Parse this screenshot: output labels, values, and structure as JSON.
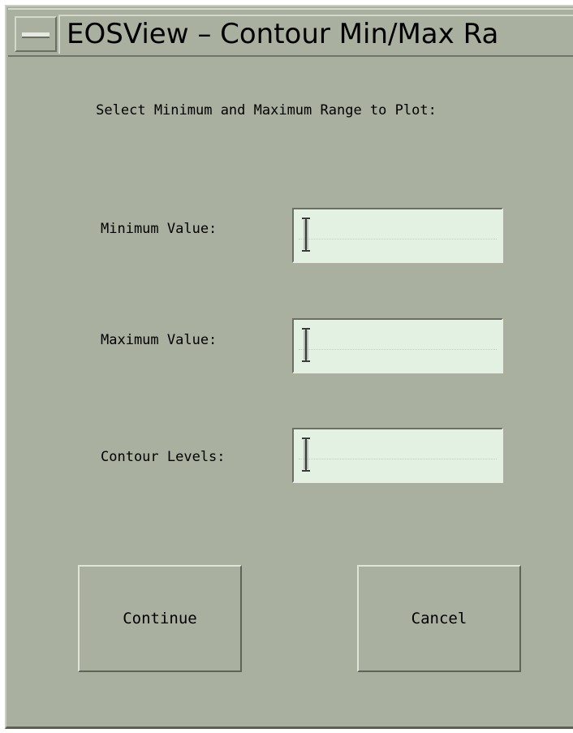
{
  "window": {
    "title": "EOSView – Contour Min/Max Ra"
  },
  "dialog": {
    "prompt": "Select Minimum and Maximum Range to Plot:",
    "fields": [
      {
        "label": "Minimum Value:",
        "value": ""
      },
      {
        "label": "Maximum Value:",
        "value": ""
      },
      {
        "label": "Contour Levels:",
        "value": ""
      }
    ],
    "buttons": {
      "continue_label": "Continue",
      "cancel_label": "Cancel"
    }
  },
  "icons": {
    "window_menu": "window-menu-icon",
    "text_cursor": "ibeam-cursor-icon"
  },
  "colors": {
    "background": "#a9b09f",
    "field_background": "#e2f1e2"
  }
}
